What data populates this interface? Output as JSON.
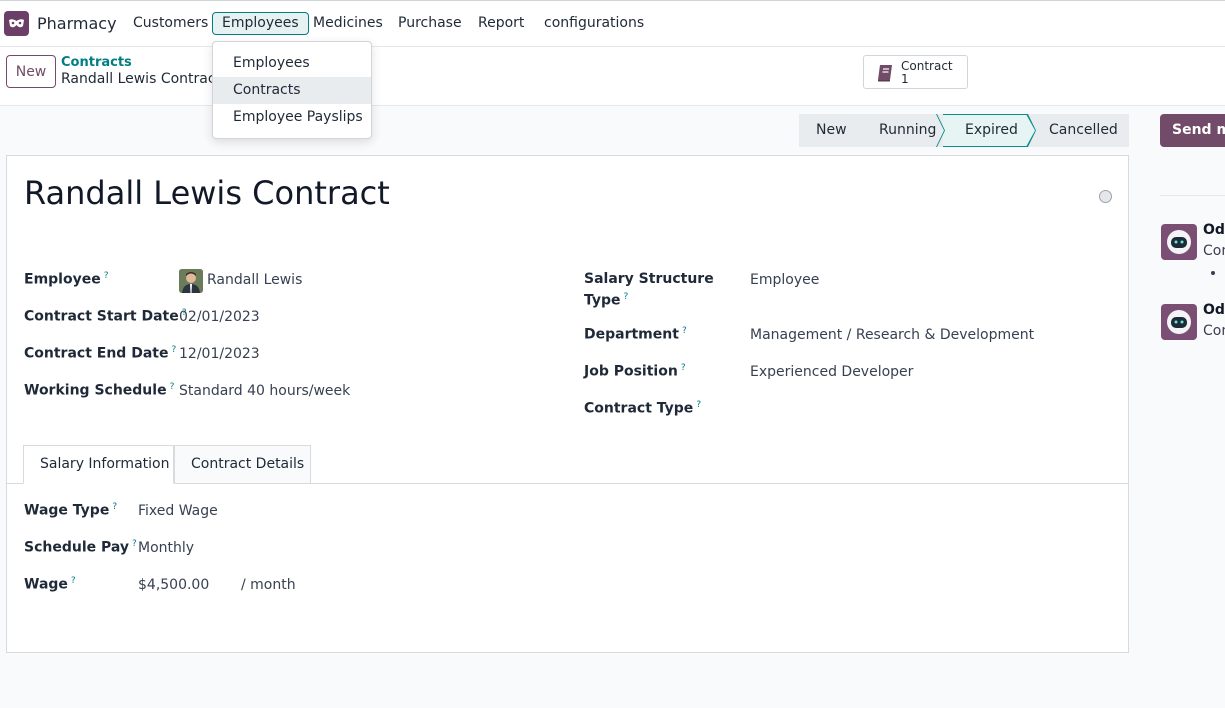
{
  "app": {
    "name": "Pharmacy",
    "menu": [
      "Customers",
      "Employees",
      "Medicines",
      "Purchase",
      "Report",
      "configurations"
    ],
    "active_menu": "Employees"
  },
  "dropdown": {
    "items": [
      "Employees",
      "Contracts",
      "Employee Payslips"
    ],
    "hovered": "Contracts"
  },
  "control": {
    "new_label": "New",
    "breadcrumb_parent": "Contracts",
    "breadcrumb_current": "Randall Lewis Contract",
    "smart_button": {
      "label": "Contract",
      "count": "1",
      "icon": "book-icon"
    }
  },
  "status": {
    "stages": [
      "New",
      "Running",
      "Expired",
      "Cancelled"
    ],
    "active": "Expired",
    "send_label": "Send me"
  },
  "form": {
    "title": "Randall Lewis Contract",
    "help_mark": "?",
    "left": [
      {
        "label": "Employee",
        "value": "Randall Lewis"
      },
      {
        "label": "Contract Start Date",
        "value": "02/01/2023"
      },
      {
        "label": "Contract End Date",
        "value": "12/01/2023"
      },
      {
        "label": "Working Schedule",
        "value": "Standard 40 hours/week"
      }
    ],
    "right": [
      {
        "label_line1": "Salary Structure",
        "label_line2": "Type",
        "value": "Employee"
      },
      {
        "label": "Department",
        "value": "Management / Research & Development"
      },
      {
        "label": "Job Position",
        "value": "Experienced Developer"
      },
      {
        "label": "Contract Type",
        "value": ""
      }
    ],
    "tabs": [
      "Salary Information",
      "Contract Details"
    ],
    "active_tab": "Salary Information",
    "salary": [
      {
        "label": "Wage Type",
        "value": "Fixed Wage"
      },
      {
        "label": "Schedule Pay",
        "value": "Monthly"
      },
      {
        "label": "Wage",
        "value": "$4,500.00",
        "suffix": "/ month"
      }
    ]
  },
  "chatter": {
    "messages": [
      {
        "author": "Odo",
        "text": "Con"
      },
      {
        "author": "Odo",
        "text": "Con"
      }
    ]
  },
  "colors": {
    "brand": "#714b67",
    "accent": "#017e84",
    "active_stage_bg": "#e6f4f3"
  }
}
